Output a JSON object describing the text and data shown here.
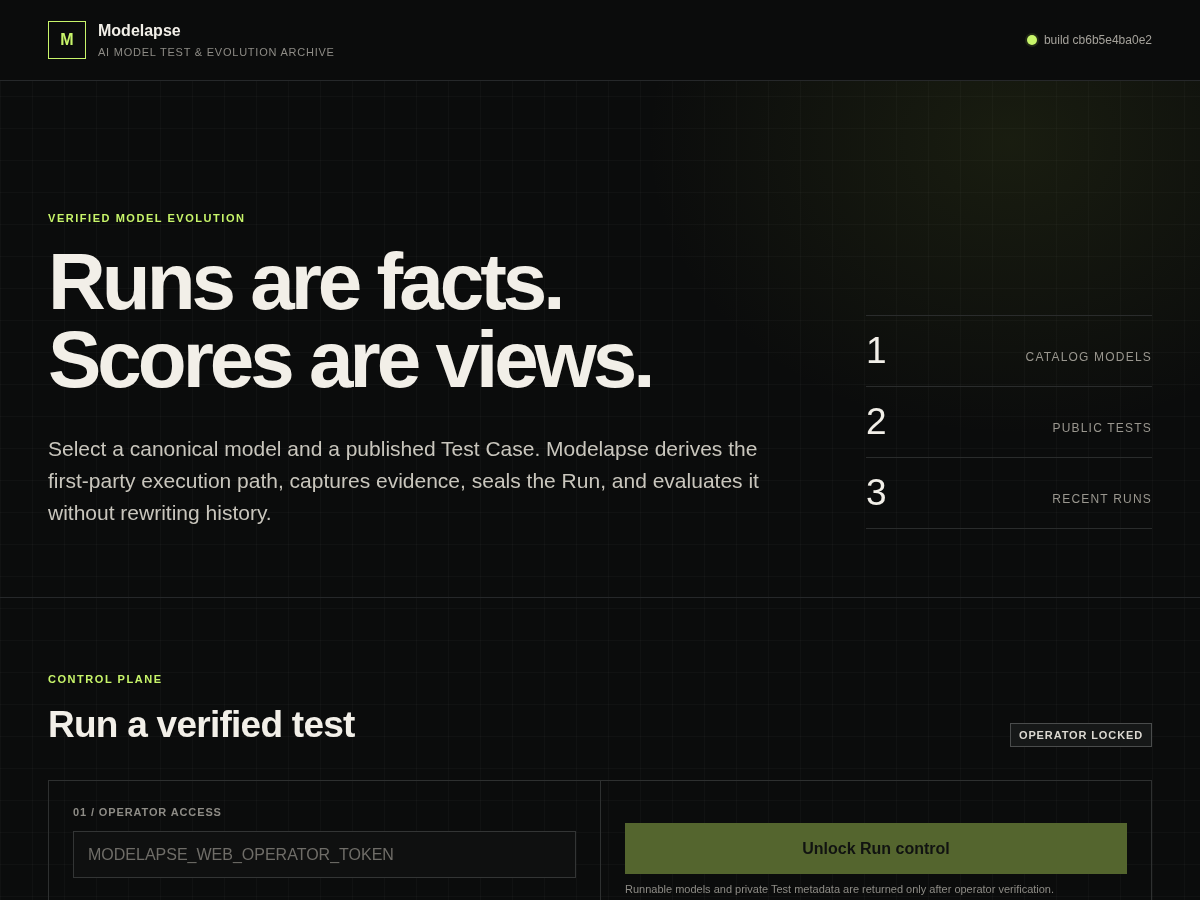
{
  "header": {
    "logo_letter": "M",
    "title": "Modelapse",
    "subtitle": "AI MODEL TEST & EVOLUTION ARCHIVE",
    "build": "build cb6b5e4ba0e2"
  },
  "hero": {
    "eyebrow": "VERIFIED MODEL EVOLUTION",
    "headline": [
      "Runs are facts.",
      "Scores are views."
    ],
    "lead": "Select a canonical model and a published Test Case. Modelapse derives the first-party execution path, captures evidence, seals the Run, and evaluates it without rewriting history.",
    "stats": [
      {
        "value": "1",
        "label": "CATALOG MODELS"
      },
      {
        "value": "2",
        "label": "PUBLIC TESTS"
      },
      {
        "value": "3",
        "label": "RECENT RUNS"
      }
    ]
  },
  "control": {
    "eyebrow": "CONTROL PLANE",
    "title": "Run a verified test",
    "status_badge": "OPERATOR LOCKED",
    "access": {
      "label": "01 / OPERATOR ACCESS",
      "placeholder": "MODELAPSE_WEB_OPERATOR_TOKEN"
    },
    "unlock_button": "Unlock Run control",
    "note": "Runnable models and private Test metadata are returned only after operator verification."
  }
}
